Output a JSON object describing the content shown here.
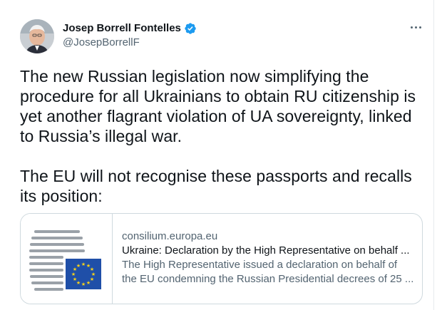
{
  "author": {
    "name": "Josep Borrell Fontelles",
    "handle": "@JosepBorrellF",
    "verified_icon": "verified-badge-icon",
    "verified_color": "#1d9bf0"
  },
  "more_icon": "more-horizontal-icon",
  "tweet": {
    "paragraph_1": "The new Russian legislation now simplifying the\nprocedure for all Ukrainians to obtain RU citizenship is\nyet another flagrant violation of UA sovereignty, linked\nto Russia’s illegal war.",
    "paragraph_2": "The EU will not recognise these passports and recalls\nits position:"
  },
  "link_card": {
    "thumbnail_icon": "council-of-eu-logo",
    "domain": "consilium.europa.eu",
    "title": "Ukraine: Declaration by the High Representative on behalf ...",
    "description": "The High Representative issued a declaration on behalf of\nthe EU condemning the Russian Presidential decrees of 25 ...",
    "flag_color": "#1f4fa8",
    "star_color": "#f7d21a"
  }
}
